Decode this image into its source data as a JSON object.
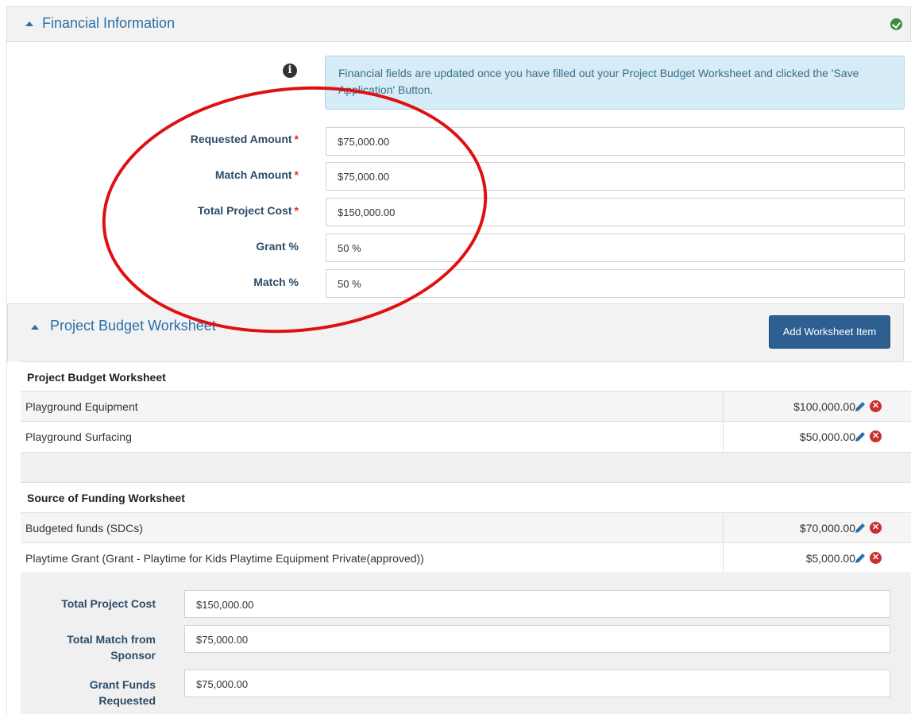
{
  "financial_panel": {
    "title": "Financial Information",
    "status_icon": "check-circle-icon"
  },
  "info": {
    "icon": "info-icon",
    "message": "Financial fields are updated once you have filled out your Project Budget Worksheet and clicked the 'Save Application' Button."
  },
  "fields": [
    {
      "label": "Requested Amount",
      "required": true,
      "value": "$75,000.00"
    },
    {
      "label": "Match Amount",
      "required": true,
      "value": "$75,000.00"
    },
    {
      "label": "Total Project Cost",
      "required": true,
      "value": "$150,000.00"
    },
    {
      "label": "Grant %",
      "required": false,
      "value": "50 %"
    },
    {
      "label": "Match %",
      "required": false,
      "value": "50 %"
    }
  ],
  "worksheet_panel": {
    "title": "Project Budget Worksheet",
    "add_button": "Add Worksheet Item"
  },
  "budget_section": {
    "title": "Project Budget Worksheet",
    "items": [
      {
        "name": "Playground Equipment",
        "amount": "$100,000.00"
      },
      {
        "name": "Playground Surfacing",
        "amount": "$50,000.00"
      }
    ]
  },
  "funding_section": {
    "title": "Source of Funding Worksheet",
    "items": [
      {
        "name": "Budgeted funds (SDCs)",
        "amount": "$70,000.00"
      },
      {
        "name": "Playtime Grant (Grant - Playtime for Kids Playtime Equipment Private(approved))",
        "amount": "$5,000.00"
      }
    ]
  },
  "summary": [
    {
      "label": "Total Project Cost",
      "value": "$150,000.00"
    },
    {
      "label_line1": "Total Match from",
      "label_line2": "Sponsor",
      "value": "$75,000.00"
    },
    {
      "label_line1": "Grant Funds",
      "label_line2": "Requested",
      "value": "$75,000.00"
    }
  ],
  "colors": {
    "accent": "#2a6fa8",
    "annotation": "#e01010",
    "button": "#2d5f91",
    "info_bg": "#d6ecf6"
  }
}
